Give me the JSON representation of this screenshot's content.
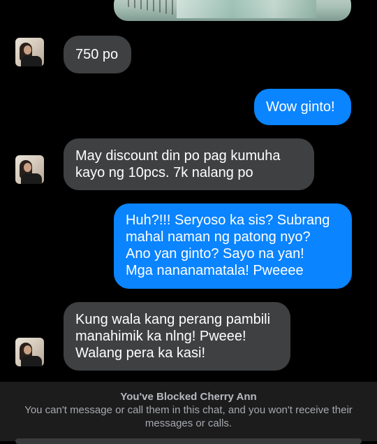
{
  "messages": [
    {
      "side": "incoming",
      "text": "750 po"
    },
    {
      "side": "outgoing",
      "text": "Wow ginto!"
    },
    {
      "side": "incoming",
      "text": "May discount din po pag kumuha\nkayo ng 10pcs. 7k nalang po"
    },
    {
      "side": "outgoing",
      "text": "Huh?!!! Seryoso ka sis? Subrang\nmahal naman ng patong nyo?\nAno yan ginto? Sayo na yan!\nMga nananamatala! Pweeee"
    },
    {
      "side": "incoming",
      "text": "Kung wala kang perang pambili\nmanahimik ka nlng! Pweee!\nWalang pera ka kasi!"
    }
  ],
  "blocked": {
    "title": "You've Blocked Cherry Ann",
    "subtitle": "You can't message or call them in this chat, and you won't receive their messages or calls."
  },
  "colors": {
    "background": "#000000",
    "incoming_bubble": "#3e4042",
    "outgoing_bubble": "#0a84ff",
    "blocked_banner": "#1c1c1d"
  }
}
